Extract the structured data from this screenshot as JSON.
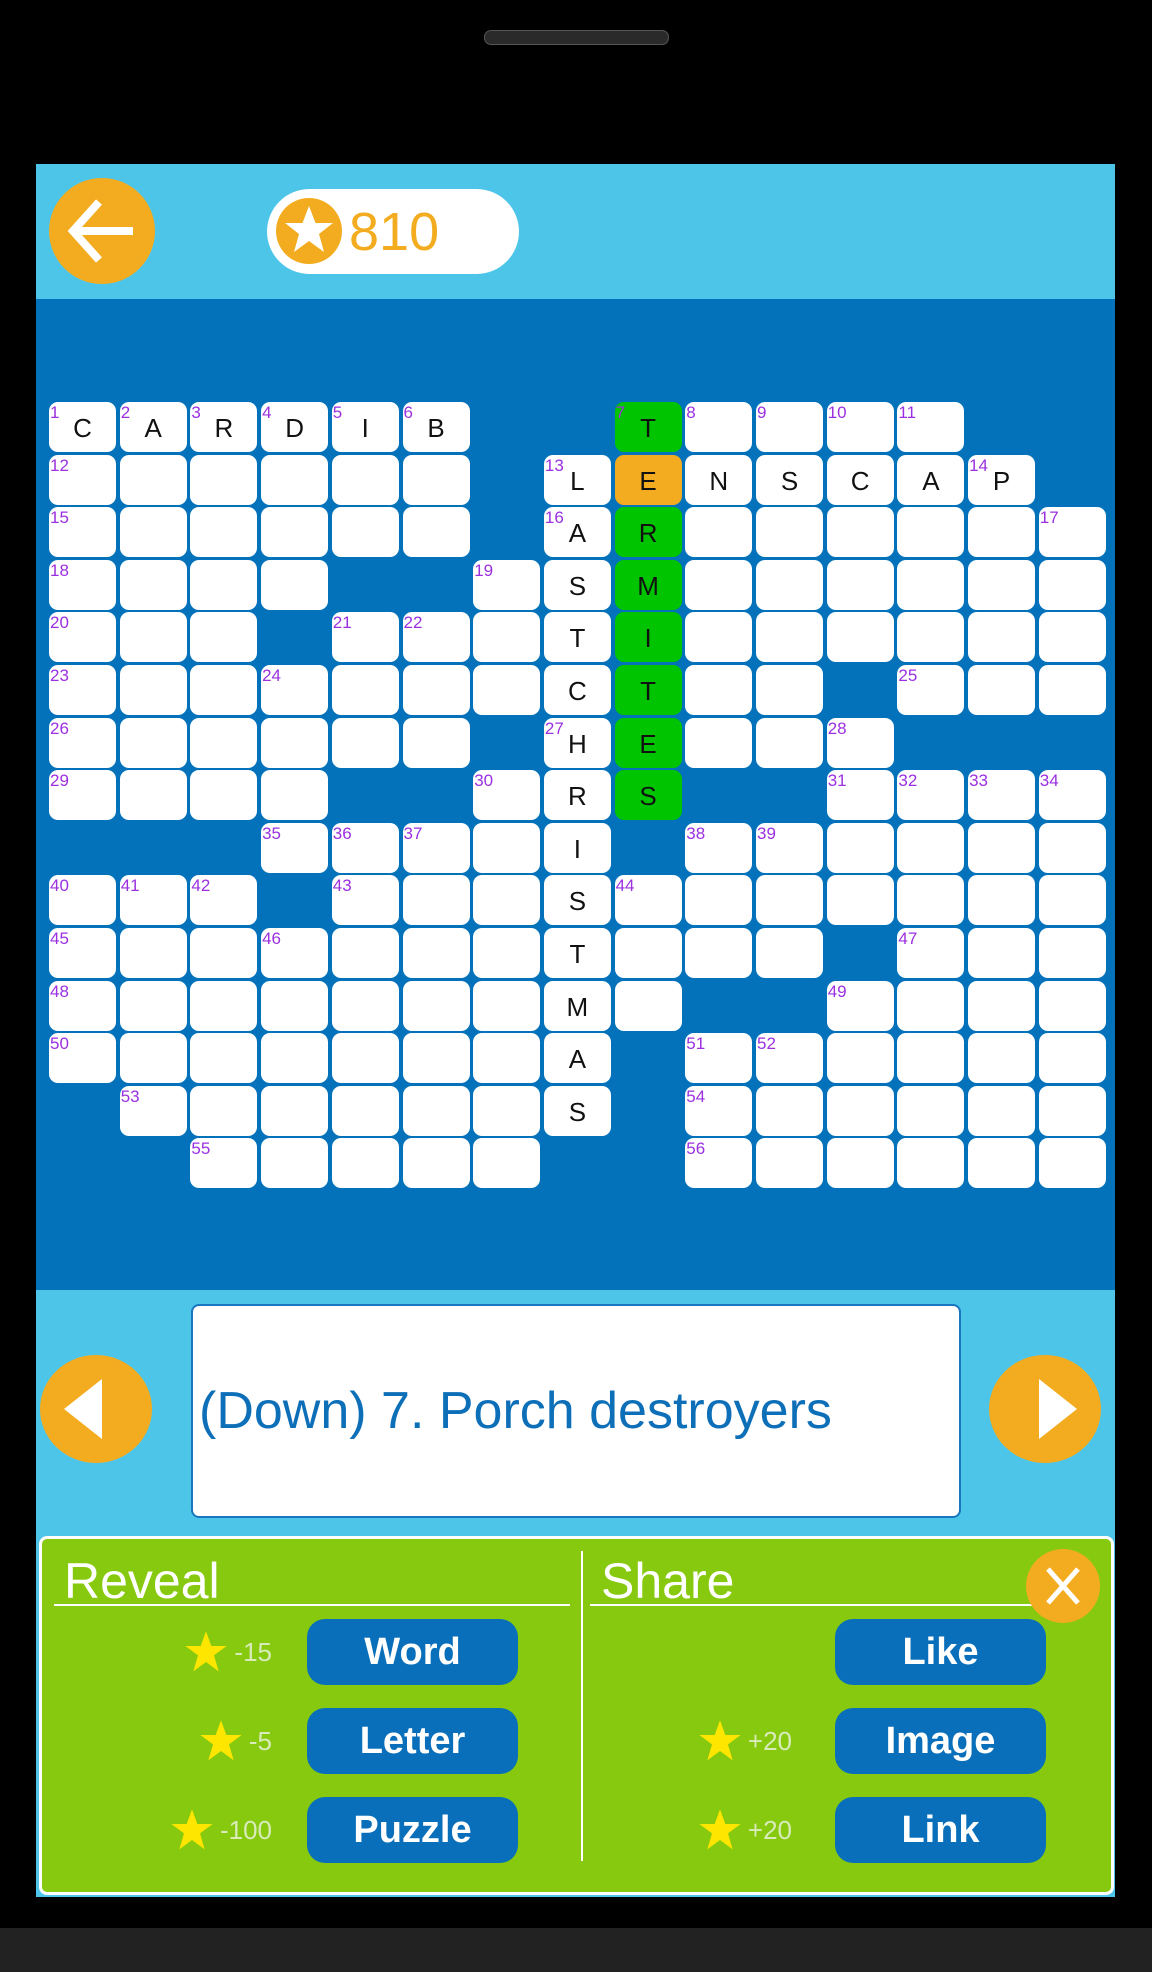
{
  "header": {
    "score": "810",
    "back_icon": "arrow-left-icon",
    "coin_icon": "star-coin-icon"
  },
  "colors": {
    "accent": "#F3AC1F",
    "board": "#0372BA",
    "header": "#4DC5E9",
    "panel": "#86C90F",
    "highlight_word": "#00C400",
    "active_cell": "#F3AC1F",
    "button": "#0A6FBA",
    "clue_number": "#9B30E0"
  },
  "grid": {
    "rows": [
      "CARDIB##T....##",
      "......#LENSCAP#",
      "......#AR......",
      "....##.SM......",
      "...#...TI......",
      ".......CT..#...",
      "......#HE...###",
      "....##.RS##....",
      "###....I#......",
      "...#...S.......",
      ".......T...#...",
      ".......M.##....",
      ".......A#......",
      "#......S#......",
      "##.....##......"
    ],
    "numbers": [
      [
        0,
        0,
        1
      ],
      [
        0,
        1,
        2
      ],
      [
        0,
        2,
        3
      ],
      [
        0,
        3,
        4
      ],
      [
        0,
        4,
        5
      ],
      [
        0,
        5,
        6
      ],
      [
        0,
        8,
        7
      ],
      [
        0,
        9,
        8
      ],
      [
        0,
        10,
        9
      ],
      [
        0,
        11,
        10
      ],
      [
        0,
        12,
        11
      ],
      [
        1,
        0,
        12
      ],
      [
        1,
        7,
        13
      ],
      [
        1,
        13,
        14
      ],
      [
        2,
        0,
        15
      ],
      [
        2,
        7,
        16
      ],
      [
        2,
        14,
        17
      ],
      [
        3,
        0,
        18
      ],
      [
        3,
        6,
        19
      ],
      [
        4,
        0,
        20
      ],
      [
        4,
        4,
        21
      ],
      [
        4,
        5,
        22
      ],
      [
        5,
        0,
        23
      ],
      [
        5,
        3,
        24
      ],
      [
        5,
        12,
        25
      ],
      [
        6,
        0,
        26
      ],
      [
        6,
        7,
        27
      ],
      [
        6,
        11,
        28
      ],
      [
        7,
        0,
        29
      ],
      [
        7,
        6,
        30
      ],
      [
        7,
        11,
        31
      ],
      [
        7,
        12,
        32
      ],
      [
        7,
        13,
        33
      ],
      [
        7,
        14,
        34
      ],
      [
        8,
        3,
        35
      ],
      [
        8,
        4,
        36
      ],
      [
        8,
        5,
        37
      ],
      [
        8,
        9,
        38
      ],
      [
        8,
        10,
        39
      ],
      [
        9,
        0,
        40
      ],
      [
        9,
        1,
        41
      ],
      [
        9,
        2,
        42
      ],
      [
        9,
        4,
        43
      ],
      [
        9,
        8,
        44
      ],
      [
        10,
        0,
        45
      ],
      [
        10,
        3,
        46
      ],
      [
        10,
        12,
        47
      ],
      [
        11,
        0,
        48
      ],
      [
        11,
        11,
        49
      ],
      [
        12,
        0,
        50
      ],
      [
        12,
        9,
        51
      ],
      [
        12,
        10,
        52
      ],
      [
        13,
        1,
        53
      ],
      [
        13,
        9,
        54
      ],
      [
        14,
        2,
        55
      ],
      [
        14,
        9,
        56
      ]
    ],
    "highlighted_word": {
      "number": 7,
      "direction": "down",
      "column": 8,
      "row_start": 0,
      "row_end": 7
    },
    "active_cell": [
      1,
      8
    ]
  },
  "clue": {
    "text": "(Down) 7. Porch destroyers",
    "prev_icon": "triangle-left-icon",
    "next_icon": "triangle-right-icon"
  },
  "panel": {
    "reveal": {
      "title": "Reveal",
      "items": [
        {
          "label": "Word",
          "cost": "-15"
        },
        {
          "label": "Letter",
          "cost": "-5"
        },
        {
          "label": "Puzzle",
          "cost": "-100"
        }
      ]
    },
    "share": {
      "title": "Share",
      "items": [
        {
          "label": "Like",
          "cost": ""
        },
        {
          "label": "Image",
          "cost": "+20"
        },
        {
          "label": "Link",
          "cost": "+20"
        }
      ]
    },
    "close_icon": "close-x-icon"
  }
}
